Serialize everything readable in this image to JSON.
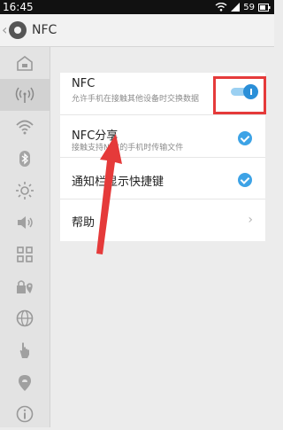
{
  "status_bar": {
    "time": "16:45",
    "battery": "59"
  },
  "title_bar": {
    "title": "NFC"
  },
  "sidebar": {
    "items": [
      {
        "name": "home-icon"
      },
      {
        "name": "nfc-signal-icon",
        "active": true
      },
      {
        "name": "wifi-icon"
      },
      {
        "name": "bluetooth-icon"
      },
      {
        "name": "brightness-icon"
      },
      {
        "name": "volume-icon"
      },
      {
        "name": "apps-grid-icon"
      },
      {
        "name": "lock-location-icon"
      },
      {
        "name": "globe-icon"
      },
      {
        "name": "hand-gesture-icon"
      },
      {
        "name": "cloud-sync-icon"
      },
      {
        "name": "info-icon"
      }
    ]
  },
  "settings": {
    "nfc": {
      "title": "NFC",
      "subtitle": "允许手机在接触其他设备时交换数据",
      "enabled": true
    },
    "nfc_share": {
      "title": "NFC分享",
      "subtitle": "接触支持NFC的手机时传输文件",
      "checked": true
    },
    "notification_shortcut": {
      "title": "通知栏显示快捷键",
      "checked": true
    },
    "help": {
      "title": "帮助"
    }
  },
  "colors": {
    "accent": "#3da3e6",
    "highlight": "#e53a3a"
  }
}
